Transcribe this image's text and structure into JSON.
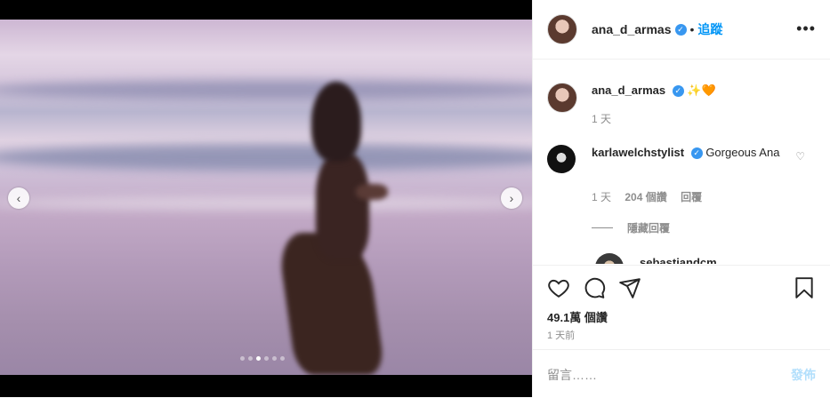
{
  "post": {
    "username": "ana_d_armas",
    "follow_label": "追蹤",
    "bullet": "•",
    "more_icon": "more-horizontal-icon",
    "verified_icon": "verified-badge-icon",
    "carousel": {
      "total_slides": 6,
      "active_index": 2
    }
  },
  "caption": {
    "username": "ana_d_armas",
    "text": "✨🧡",
    "time": "1 天"
  },
  "comment": {
    "username": "karlawelchstylist",
    "text": "Gorgeous Ana",
    "time": "1 天",
    "likes": "204 個讚",
    "reply_label": "回覆",
    "hidden_replies": "隱藏回覆"
  },
  "reply": {
    "username": "sebastiandcm"
  },
  "actions": {
    "likes": "49.1萬 個讚",
    "time": "1 天前",
    "icons": [
      "heart-icon",
      "comment-icon",
      "share-icon",
      "bookmark-icon"
    ]
  },
  "add_comment": {
    "placeholder": "留言……",
    "post_label": "發佈"
  }
}
